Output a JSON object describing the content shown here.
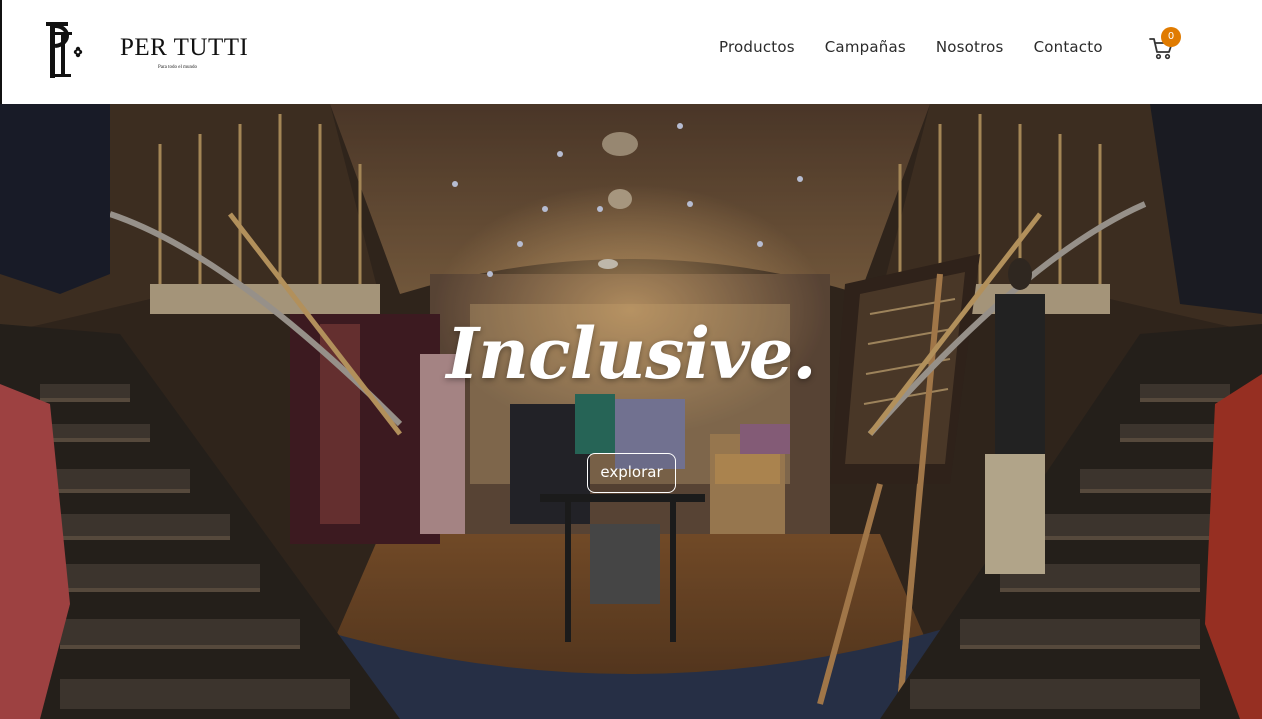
{
  "brand": {
    "name": "PER TUTTI",
    "tagline": "Para todo el mundo",
    "monogram_icon": "pt-monogram-icon"
  },
  "nav": {
    "items": [
      "Productos",
      "Campañas",
      "Nosotros",
      "Contacto"
    ]
  },
  "cart": {
    "icon": "cart-icon",
    "count": "0",
    "badge_color": "#e07b00"
  },
  "hero": {
    "title": "Inclusive.",
    "button_label": "explorar",
    "background_image": "store-interior-staircase-photo"
  }
}
